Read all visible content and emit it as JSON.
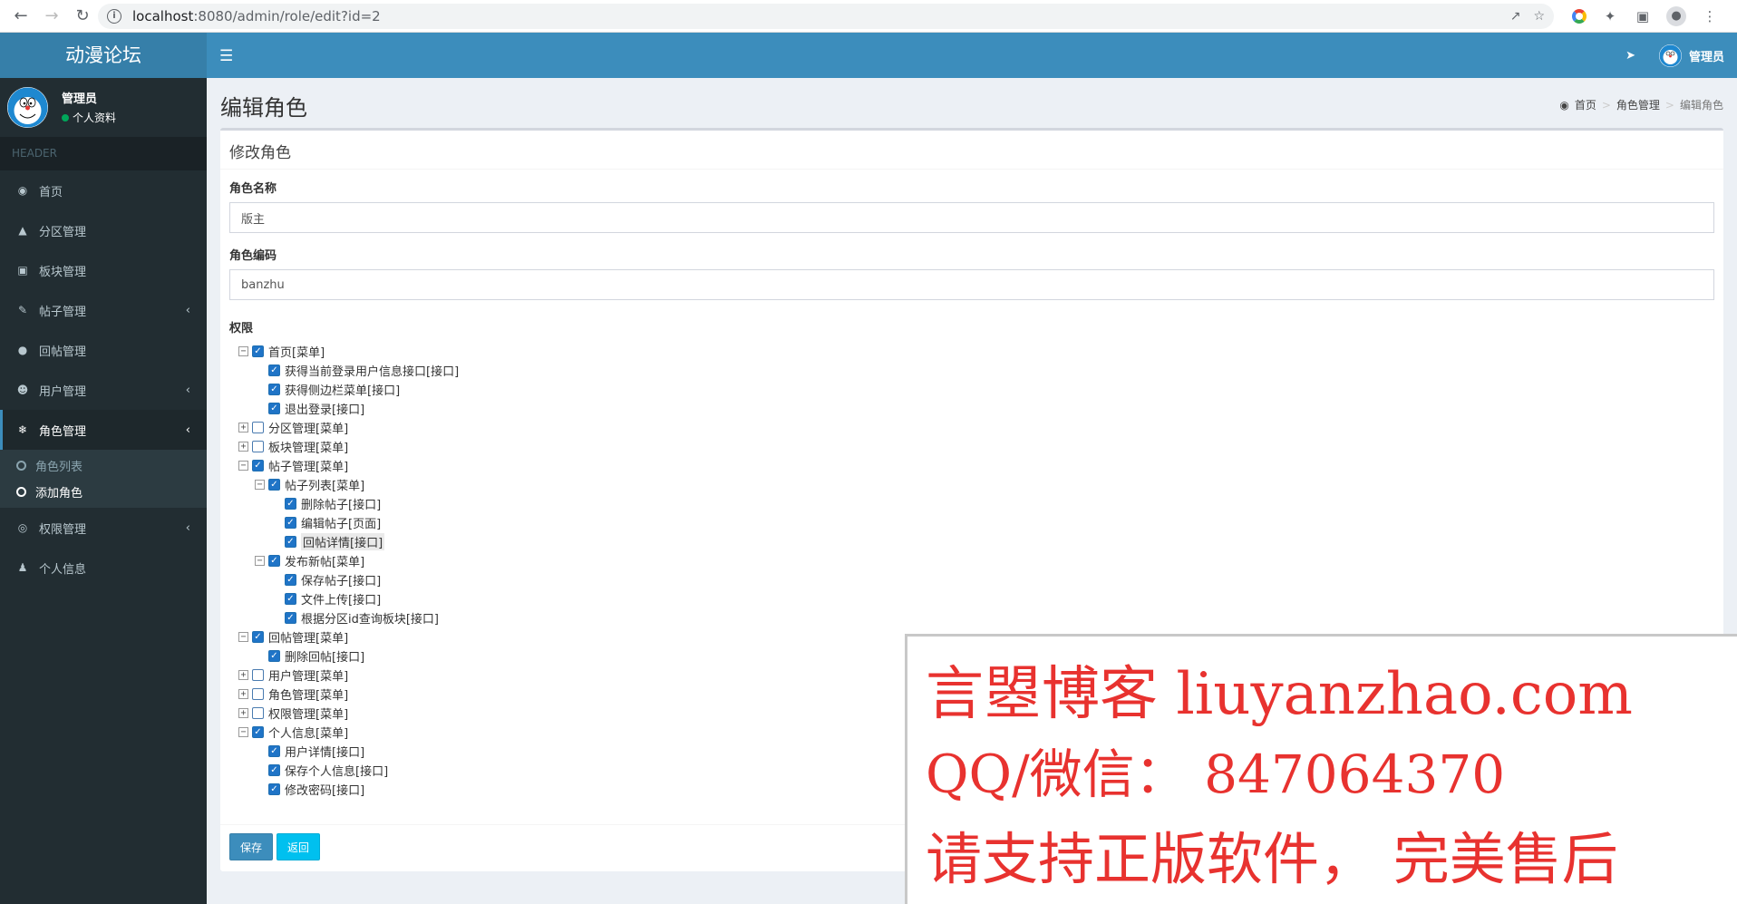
{
  "browser": {
    "url_host": "localhost",
    "url_path": ":8080/admin/role/edit?id=2"
  },
  "app": {
    "logo": "动漫论坛",
    "user_name": "管理员",
    "user_status": "个人资料",
    "side_header": "HEADER",
    "nav_user": "管理员"
  },
  "menu": [
    {
      "label": "首页",
      "icon": "dashboard-icon"
    },
    {
      "label": "分区管理",
      "icon": "area-chart-icon"
    },
    {
      "label": "板块管理",
      "icon": "book-icon"
    },
    {
      "label": "帖子管理",
      "icon": "paint-brush-icon"
    },
    {
      "label": "回帖管理",
      "icon": "comments-icon"
    },
    {
      "label": "用户管理",
      "icon": "users-icon"
    },
    {
      "label": "角色管理",
      "icon": "snowflake-icon"
    },
    {
      "label": "权限管理",
      "icon": "life-ring-icon"
    },
    {
      "label": "个人信息",
      "icon": "user-icon"
    }
  ],
  "submenu": [
    {
      "label": "角色列表"
    },
    {
      "label": "添加角色"
    }
  ],
  "page": {
    "title": "编辑角色",
    "breadcrumb": [
      "首页",
      "角色管理",
      "编辑角色"
    ],
    "box_title": "修改角色",
    "name_label": "角色名称",
    "name_value": "版主",
    "code_label": "角色编码",
    "code_value": "banzhu",
    "perm_label": "权限",
    "save": "保存",
    "back": "返回"
  },
  "tree": [
    {
      "label": "首页[菜单]",
      "level": 0,
      "toggle": "minus",
      "checked": true
    },
    {
      "label": "获得当前登录用户信息接口[接口]",
      "level": 1,
      "toggle": "none",
      "checked": true
    },
    {
      "label": "获得侧边栏菜单[接口]",
      "level": 1,
      "toggle": "none",
      "checked": true
    },
    {
      "label": "退出登录[接口]",
      "level": 1,
      "toggle": "none",
      "checked": true
    },
    {
      "label": "分区管理[菜单]",
      "level": 0,
      "toggle": "plus",
      "checked": false
    },
    {
      "label": "板块管理[菜单]",
      "level": 0,
      "toggle": "plus",
      "checked": false
    },
    {
      "label": "帖子管理[菜单]",
      "level": 0,
      "toggle": "minus",
      "checked": true
    },
    {
      "label": "帖子列表[菜单]",
      "level": 1,
      "toggle": "minus",
      "checked": true
    },
    {
      "label": "删除帖子[接口]",
      "level": 2,
      "toggle": "none",
      "checked": true
    },
    {
      "label": "编辑帖子[页面]",
      "level": 2,
      "toggle": "none",
      "checked": true
    },
    {
      "label": "回帖详情[接口]",
      "level": 2,
      "toggle": "none",
      "checked": true
    },
    {
      "label": "发布新帖[菜单]",
      "level": 1,
      "toggle": "minus",
      "checked": true
    },
    {
      "label": "保存帖子[接口]",
      "level": 2,
      "toggle": "none",
      "checked": true
    },
    {
      "label": "文件上传[接口]",
      "level": 2,
      "toggle": "none",
      "checked": true
    },
    {
      "label": "根据分区id查询板块[接口]",
      "level": 2,
      "toggle": "none",
      "checked": true
    },
    {
      "label": "回帖管理[菜单]",
      "level": 0,
      "toggle": "minus",
      "checked": true
    },
    {
      "label": "删除回帖[接口]",
      "level": 1,
      "toggle": "none",
      "checked": true
    },
    {
      "label": "用户管理[菜单]",
      "level": 0,
      "toggle": "plus",
      "checked": false
    },
    {
      "label": "角色管理[菜单]",
      "level": 0,
      "toggle": "plus",
      "checked": false
    },
    {
      "label": "权限管理[菜单]",
      "level": 0,
      "toggle": "plus",
      "checked": false
    },
    {
      "label": "个人信息[菜单]",
      "level": 0,
      "toggle": "minus",
      "checked": true
    },
    {
      "label": "用户详情[接口]",
      "level": 1,
      "toggle": "none",
      "checked": true
    },
    {
      "label": "保存个人信息[接口]",
      "level": 1,
      "toggle": "none",
      "checked": true
    },
    {
      "label": "修改密码[接口]",
      "level": 1,
      "toggle": "none",
      "checked": true
    }
  ],
  "watermark": {
    "line1": "言曌博客 liuyanzhao.com",
    "line2": "QQ/微信：  847064370",
    "line3": "请支持正版软件， 完美售后"
  }
}
